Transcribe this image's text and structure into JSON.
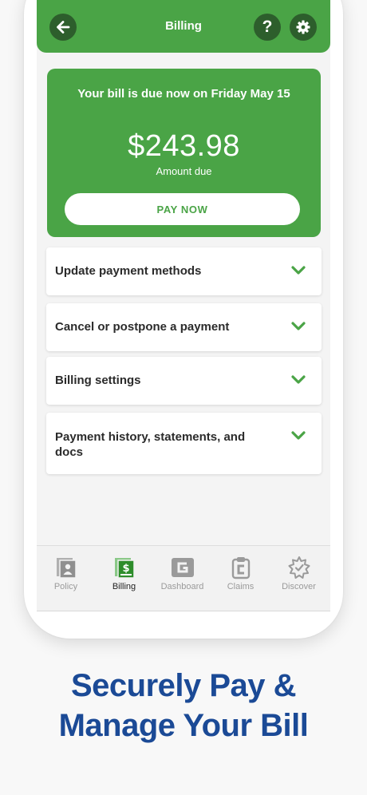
{
  "header": {
    "title": "Billing",
    "back_icon": "arrow-left-icon",
    "help_label": "?",
    "settings_icon": "gear-icon"
  },
  "bill": {
    "due_text": "Your bill is due now on Friday May 15",
    "amount": "$243.98",
    "amount_label": "Amount due",
    "pay_label": "PAY NOW"
  },
  "sections": [
    {
      "label": "Update payment methods"
    },
    {
      "label": "Cancel or postpone a payment"
    },
    {
      "label": "Billing settings"
    },
    {
      "label": "Payment history, statements, and docs"
    }
  ],
  "tabs": [
    {
      "label": "Policy",
      "icon": "policy-icon",
      "active": false
    },
    {
      "label": "Billing",
      "icon": "billing-icon",
      "active": true
    },
    {
      "label": "Dashboard",
      "icon": "dashboard-icon",
      "active": false
    },
    {
      "label": "Claims",
      "icon": "claims-icon",
      "active": false
    },
    {
      "label": "Discover",
      "icon": "discover-icon",
      "active": false
    }
  ],
  "headline": {
    "line1": "Securely Pay &",
    "line2": "Manage Your Bill"
  },
  "colors": {
    "brand_green": "#4aa446",
    "dark_green": "#2d5e2c",
    "headline_blue": "#1b4a96",
    "tab_inactive": "#9a9a9a"
  }
}
